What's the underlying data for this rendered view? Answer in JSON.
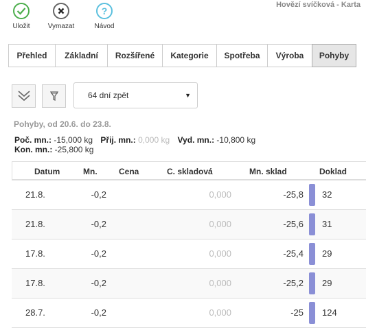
{
  "toolbar": {
    "save_label": "Uložit",
    "delete_label": "Vymazat",
    "help_label": "Návod",
    "help_glyph": "?"
  },
  "window_title": "Hovězí svíčková - Karta",
  "tabs": [
    "Přehled",
    "Základní",
    "Rozšířené",
    "Kategorie",
    "Spotřeba",
    "Výroba",
    "Pohyby"
  ],
  "active_tab": "Pohyby",
  "filter": {
    "selected": "64 dní zpět"
  },
  "period_label": "Pohyby, od 20.6. do 23.8.",
  "summary": {
    "poc_label": "Poč. mn.:",
    "poc_value": "-15,000 kg",
    "prij_label": "Přij. mn.:",
    "prij_value": "0,000 kg",
    "vyd_label": "Vyd. mn.:",
    "vyd_value": "-10,800 kg",
    "kon_label": "Kon. mn.:",
    "kon_value": "-25,800 kg"
  },
  "table": {
    "columns": [
      "Datum",
      "Mn.",
      "Cena",
      "C. skladová",
      "Mn. sklad",
      "Doklad"
    ],
    "rows": [
      {
        "datum": "21.8.",
        "mn": "-0,2",
        "cena": "",
        "c_skladova": "0,000",
        "mn_sklad": "-25,8",
        "doklad": "32"
      },
      {
        "datum": "21.8.",
        "mn": "-0,2",
        "cena": "",
        "c_skladova": "0,000",
        "mn_sklad": "-25,6",
        "doklad": "31"
      },
      {
        "datum": "17.8.",
        "mn": "-0,2",
        "cena": "",
        "c_skladova": "0,000",
        "mn_sklad": "-25,4",
        "doklad": "29"
      },
      {
        "datum": "17.8.",
        "mn": "-0,2",
        "cena": "",
        "c_skladova": "0,000",
        "mn_sklad": "-25,2",
        "doklad": "29"
      },
      {
        "datum": "28.7.",
        "mn": "-0,2",
        "cena": "",
        "c_skladova": "0,000",
        "mn_sklad": "-25",
        "doklad": "124"
      }
    ]
  },
  "colors": {
    "save": "#4cae4c",
    "help": "#5bc0de",
    "doc_bar": "#8a8fd6"
  }
}
